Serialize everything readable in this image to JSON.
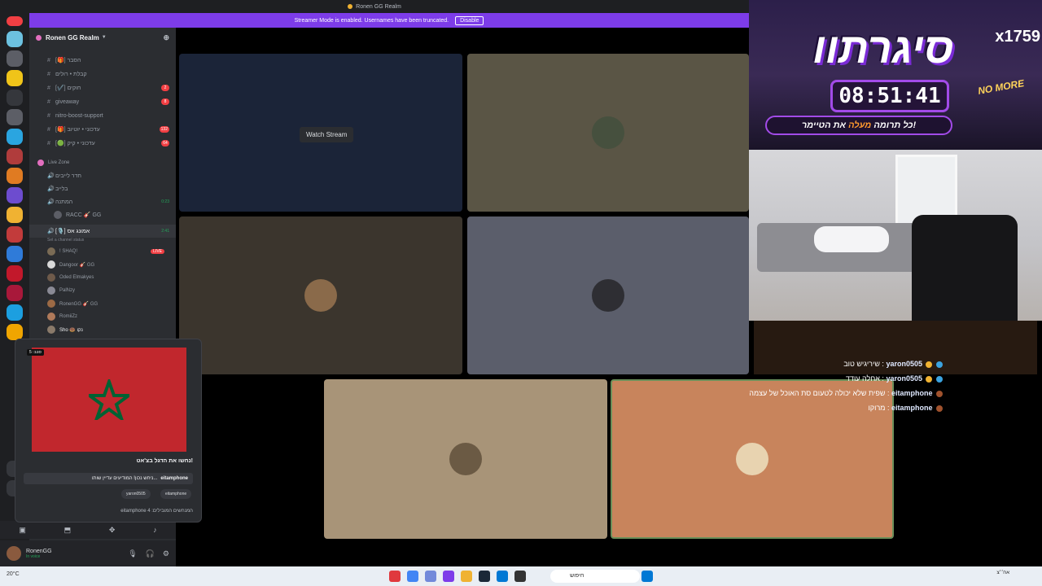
{
  "titlebar": {
    "title": "Ronen GG Realm"
  },
  "streamer_bar": {
    "text": "Streamer Mode is enabled. Usernames have been truncated.",
    "disable_label": "Disable"
  },
  "guild": {
    "name": "Ronen GG Realm"
  },
  "channels": [
    {
      "name": "[🎁] הסבר",
      "badge": ""
    },
    {
      "name": "קבלת • רולים",
      "badge": ""
    },
    {
      "name": "[✔️] חוקים",
      "badge": "2"
    },
    {
      "name": "giveaway",
      "badge": "8"
    },
    {
      "name": "nitro-boost-support",
      "badge": ""
    },
    {
      "name": "[🎁] עדכוני • יוטיוב",
      "badge": "132"
    },
    {
      "name": "[🟢] עדכוני • קיק",
      "badge": "64"
    }
  ],
  "category": {
    "name": "Live Zone"
  },
  "voice_channels": [
    {
      "name": "חדר לייבים"
    },
    {
      "name": "בלייב"
    },
    {
      "name": "המתנה",
      "time": "0:23"
    },
    {
      "name": "RACC 🎸 GG"
    },
    {
      "name": "[🎙️] אמונג אס",
      "time": "2:41",
      "status": "Set a channel status"
    }
  ],
  "voice_users": [
    {
      "name": "! SHAQ!",
      "live": "LIVE"
    },
    {
      "name": "Dangoor 🎸 GG"
    },
    {
      "name": "Oded Elmakyes"
    },
    {
      "name": "PalNzy"
    },
    {
      "name": "RonenGG 🎸 GG"
    },
    {
      "name": "RomiiZz"
    },
    {
      "name": "Sho 🍩 נקו"
    }
  ],
  "user_panel": {
    "name": "RonenGG",
    "status": "In voice"
  },
  "stage": {
    "watch_label": "Watch Stream"
  },
  "popup": {
    "timer": "5 :סבב",
    "question": "נחשו את הדגל בצ'אט!",
    "answer_user": "eitamphone",
    "answer_text": "ניחש נכון! המודיעים עדיין שותו...",
    "pills": [
      "yaron0505",
      "eitamphone"
    ],
    "footer": "eitamphone 4 :המנחשים המובילים"
  },
  "overlay": {
    "title": "סיגרתוו",
    "counter": "x1759",
    "timer": "08:51:41",
    "subtitle_pre": "כל תרומה",
    "subtitle_hl": "מעלה",
    "subtitle_post": "את הטיימר!",
    "nomore": "NO MORE"
  },
  "chat": [
    {
      "user": "yaron0505",
      "text": "שיריגיש טוב :"
    },
    {
      "user": "yaron0505",
      "text": "אחלה עודד :"
    },
    {
      "user": "eitamphone",
      "text": "שפית שלא יכולה לטעום סת האוכל של עצמה :"
    },
    {
      "user": "eitamphone",
      "text": "מרוקו :"
    }
  ],
  "taskbar": {
    "search": "חיפוש",
    "time": "אח׳׳צ",
    "weather": "20°C"
  },
  "colors": {
    "accent": "#7d3ce9",
    "live": "#f23f43",
    "flag_red": "#c1272d",
    "flag_green": "#006233"
  }
}
